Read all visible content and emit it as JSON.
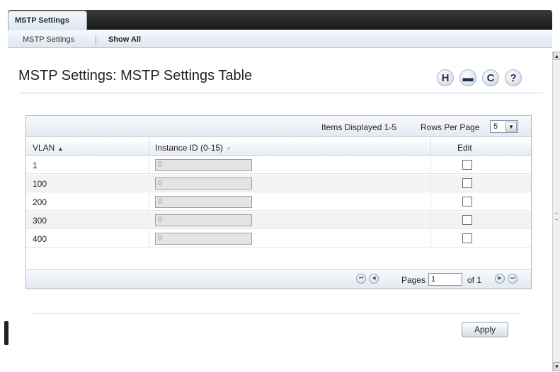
{
  "top_tab": {
    "label": "MSTP Settings"
  },
  "subnav": {
    "items": [
      "MSTP Settings",
      "Show All"
    ]
  },
  "page": {
    "title": "MSTP Settings: MSTP Settings Table"
  },
  "toolbar": {
    "icons": [
      "save-icon",
      "print-icon",
      "refresh-icon",
      "help-icon"
    ],
    "glyphs": [
      "H",
      "▬",
      "C",
      "?"
    ]
  },
  "table": {
    "items_displayed": "Items Displayed 1-5",
    "rows_per_page_label": "Rows Per Page",
    "rows_per_page_value": "5",
    "columns": [
      "VLAN",
      "Instance ID (0-15)",
      "Edit"
    ],
    "rows": [
      {
        "vlan": "1",
        "instance_id": "0",
        "edit": false
      },
      {
        "vlan": "100",
        "instance_id": "0",
        "edit": false
      },
      {
        "vlan": "200",
        "instance_id": "0",
        "edit": false
      },
      {
        "vlan": "300",
        "instance_id": "0",
        "edit": false
      },
      {
        "vlan": "400",
        "instance_id": "0",
        "edit": false
      }
    ],
    "pagination": {
      "pages_label": "Pages",
      "current_page": "1",
      "of_label": "of 1"
    }
  },
  "actions": {
    "apply_label": "Apply"
  }
}
